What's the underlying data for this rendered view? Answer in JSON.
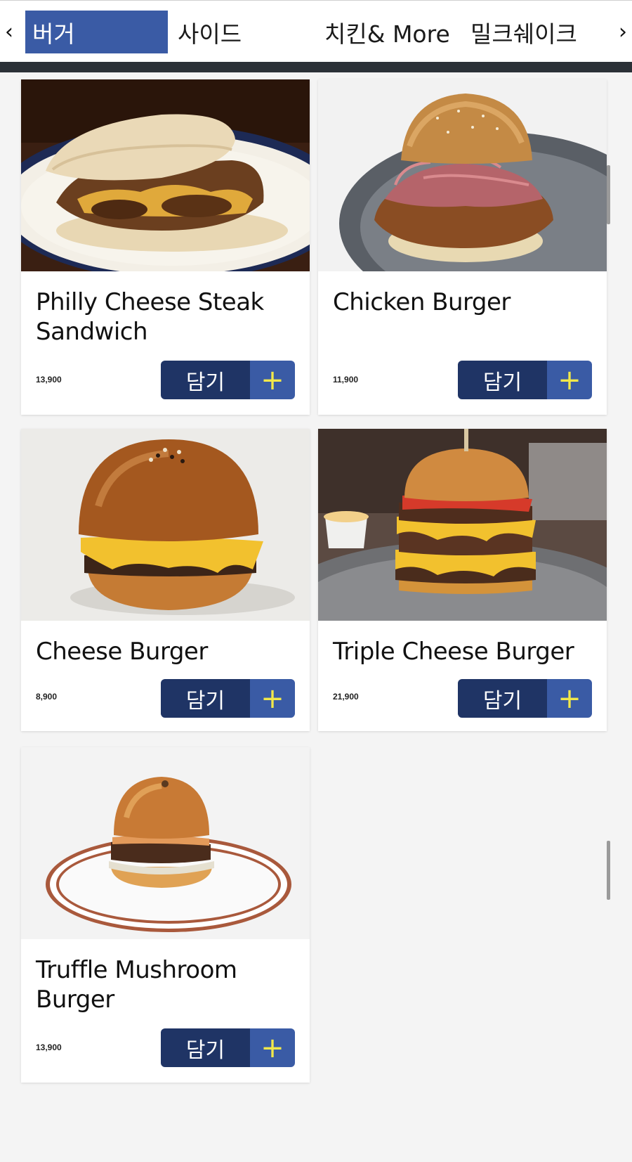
{
  "nav": {
    "prev_icon": "chevron-left-icon",
    "next_icon": "chevron-right-icon",
    "prev_glyph": "‹",
    "next_glyph": "›",
    "tabs": [
      {
        "label": "버거",
        "active": true
      },
      {
        "label": "사이드",
        "active": false
      },
      {
        "label": "치킨& More",
        "active": false
      },
      {
        "label": "밀크쉐이크",
        "active": false
      }
    ]
  },
  "products": [
    {
      "name": "Philly Cheese Steak Sandwich",
      "price": "13,900",
      "add_label": "담기",
      "add_icon": "plus-icon",
      "add_glyph": "+"
    },
    {
      "name": "Chicken Burger",
      "price": "11,900",
      "add_label": "담기",
      "add_icon": "plus-icon",
      "add_glyph": "+"
    },
    {
      "name": "Cheese Burger",
      "price": "8,900",
      "add_label": "담기",
      "add_icon": "plus-icon",
      "add_glyph": "+"
    },
    {
      "name": "Triple Cheese Burger",
      "price": "21,900",
      "add_label": "담기",
      "add_icon": "plus-icon",
      "add_glyph": "+"
    },
    {
      "name": "Truffle Mushroom Burger",
      "price": "13,900",
      "add_label": "담기",
      "add_icon": "plus-icon",
      "add_glyph": "+"
    }
  ],
  "colors": {
    "active_tab": "#3a5ba5",
    "button_dark": "#1f3465",
    "button_light": "#3a5ba5",
    "plus_color": "#f2e84a",
    "page_bg": "#f4f4f4"
  }
}
